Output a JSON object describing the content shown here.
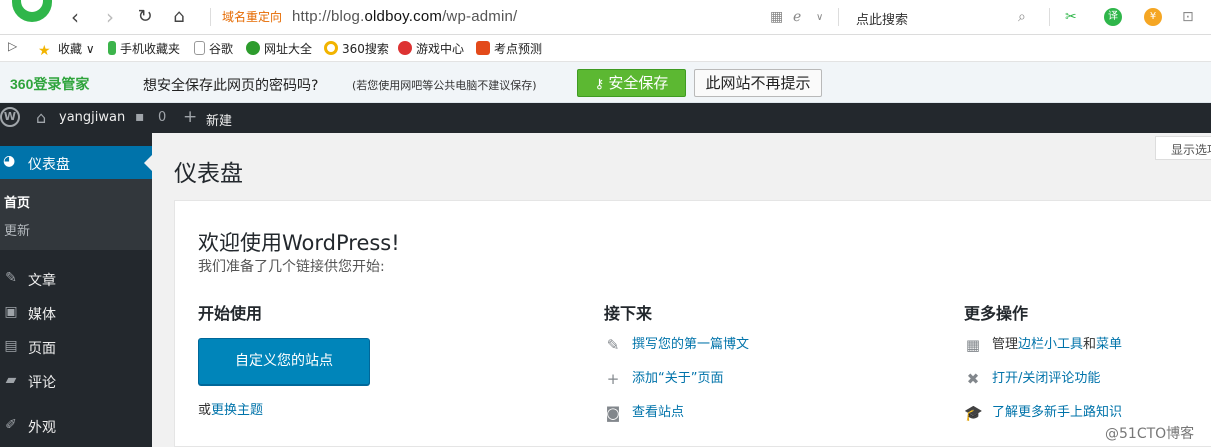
{
  "browser": {
    "address_tag": "域名重定向",
    "url_pre": "http://blog.",
    "url_domain": "oldboy.com",
    "url_post": "/wp-admin/",
    "search_placeholder": "点此搜索"
  },
  "bookmarks": [
    {
      "label": "收藏",
      "color": "#f2b400"
    },
    {
      "label": "手机收藏夹",
      "color": "#3cb44b"
    },
    {
      "label": "谷歌",
      "color": "#bbbbbb"
    },
    {
      "label": "网址大全",
      "color": "#2d9c2d"
    },
    {
      "label": "360搜索",
      "color": "#2fb64a"
    },
    {
      "label": "游戏中心",
      "color": "#d33"
    },
    {
      "label": "考点预测",
      "color": "#e34a1a"
    }
  ],
  "password_bar": {
    "brand": "360登录管家",
    "question": "想安全保存此网页的密码吗?",
    "note": "(若您使用网吧等公共电脑不建议保存)",
    "save_label": "安全保存",
    "never_label": "此网站不再提示"
  },
  "admin_bar": {
    "site_name": "yangjiwan",
    "comments_count": "0",
    "new_label": "新建"
  },
  "sidebar": {
    "dashboard": "仪表盘",
    "sub_home": "首页",
    "sub_update": "更新",
    "items": [
      {
        "label": "文章",
        "icon": "pin-icon"
      },
      {
        "label": "媒体",
        "icon": "media-icon"
      },
      {
        "label": "页面",
        "icon": "page-icon"
      },
      {
        "label": "评论",
        "icon": "comment-icon"
      },
      {
        "label": "外观",
        "icon": "brush-icon"
      }
    ]
  },
  "main": {
    "screen_options": "显示选项",
    "title": "仪表盘",
    "welcome_title": "欢迎使用WordPress!",
    "welcome_sub": "我们准备了几个链接供您开始:",
    "col1_title": "开始使用",
    "customize_button": "自定义您的站点",
    "change_theme_prefix": "或",
    "change_theme_link": "更换主题",
    "col2_title": "接下来",
    "next_links": [
      "撰写您的第一篇博文",
      "添加“关于”页面",
      "查看站点"
    ],
    "col3_title": "更多操作",
    "more_1_prefix": "管理",
    "more_1_link_a": "边栏小工具",
    "more_1_mid": "和",
    "more_1_link_b": "菜单",
    "more_2": "打开/关闭评论功能",
    "more_3": "了解更多新手上路知识"
  },
  "watermark": "@51CTO博客"
}
